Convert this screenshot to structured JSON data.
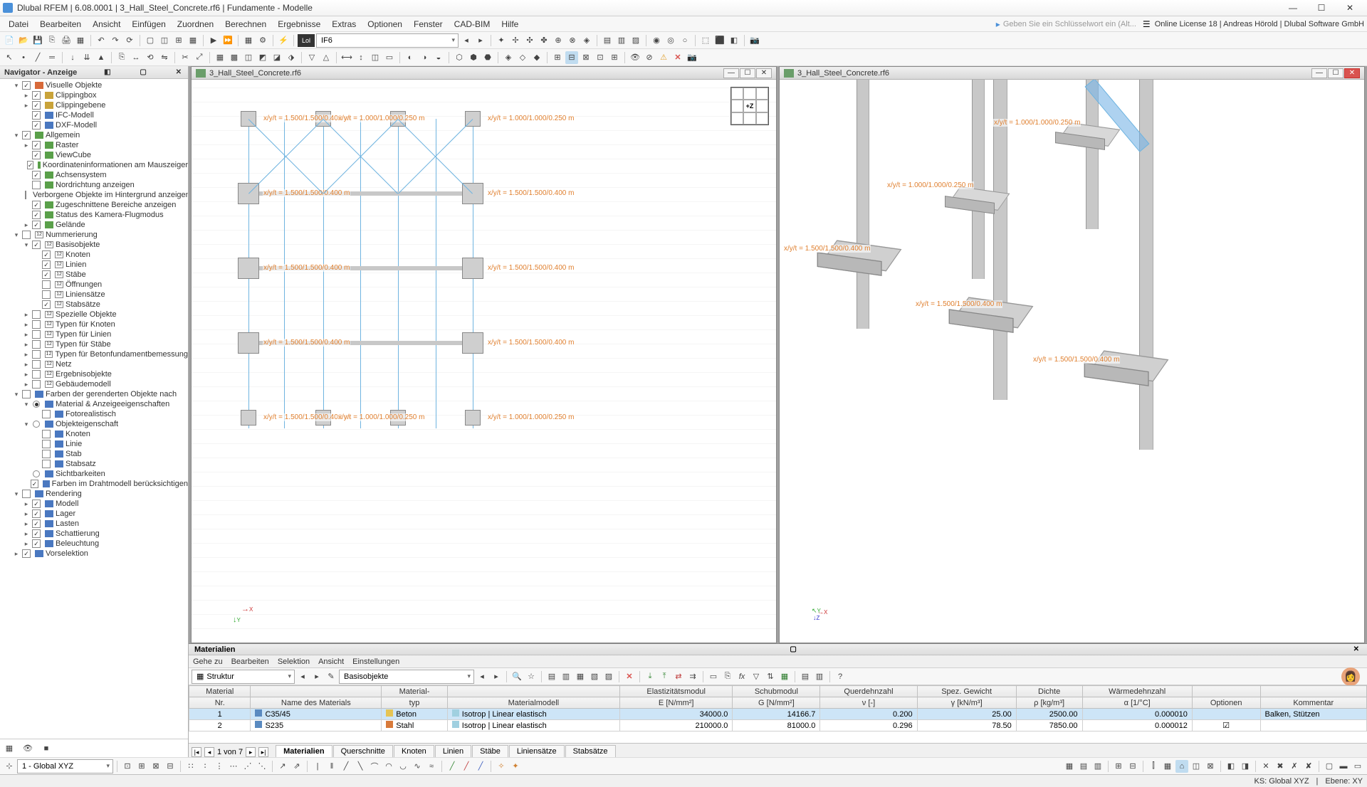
{
  "app": {
    "title": "Dlubal RFEM | 6.08.0001 | 3_Hall_Steel_Concrete.rf6 | Fundamente - Modelle",
    "search_placeholder": "Geben Sie ein Schlüsselwort ein (Alt...",
    "license": "Online License 18 | Andreas Hörold | Dlubal Software GmbH"
  },
  "menu": [
    "Datei",
    "Bearbeiten",
    "Ansicht",
    "Einfügen",
    "Zuordnen",
    "Berechnen",
    "Ergebnisse",
    "Extras",
    "Optionen",
    "Fenster",
    "CAD-BIM",
    "Hilfe"
  ],
  "toolbar2_combo": "IF6",
  "navigator": {
    "title": "Navigator - Anzeige",
    "items": [
      {
        "d": 1,
        "t": "exp",
        "chk": true,
        "ic": "col1",
        "label": "Visuelle Objekte"
      },
      {
        "d": 2,
        "t": "col",
        "chk": true,
        "ic": "col4",
        "label": "Clippingbox"
      },
      {
        "d": 2,
        "t": "col",
        "chk": true,
        "ic": "col4",
        "label": "Clippingebene"
      },
      {
        "d": 2,
        "t": "",
        "chk": true,
        "ic": "col3",
        "label": "IFC-Modell"
      },
      {
        "d": 2,
        "t": "",
        "chk": true,
        "ic": "col3",
        "label": "DXF-Modell"
      },
      {
        "d": 1,
        "t": "exp",
        "chk": true,
        "ic": "col2",
        "label": "Allgemein"
      },
      {
        "d": 2,
        "t": "col",
        "chk": true,
        "ic": "col2",
        "label": "Raster"
      },
      {
        "d": 2,
        "t": "",
        "chk": true,
        "ic": "col2",
        "label": "ViewCube"
      },
      {
        "d": 2,
        "t": "",
        "chk": true,
        "ic": "col2",
        "label": "Koordinateninformationen am Mauszeiger"
      },
      {
        "d": 2,
        "t": "",
        "chk": true,
        "ic": "col2",
        "label": "Achsensystem"
      },
      {
        "d": 2,
        "t": "",
        "chk": false,
        "ic": "col2",
        "label": "Nordrichtung anzeigen"
      },
      {
        "d": 2,
        "t": "",
        "chk": false,
        "ic": "col2",
        "label": "Verborgene Objekte im Hintergrund anzeigen"
      },
      {
        "d": 2,
        "t": "",
        "chk": true,
        "ic": "col2",
        "label": "Zugeschnittene Bereiche anzeigen"
      },
      {
        "d": 2,
        "t": "",
        "chk": true,
        "ic": "col2",
        "label": "Status des Kamera-Flugmodus"
      },
      {
        "d": 2,
        "t": "col",
        "chk": true,
        "ic": "col2",
        "label": "Gelände"
      },
      {
        "d": 1,
        "t": "exp",
        "chk": false,
        "ic": "num",
        "label": "Nummerierung"
      },
      {
        "d": 2,
        "t": "exp",
        "chk": true,
        "ic": "num",
        "label": "Basisobjekte"
      },
      {
        "d": 3,
        "t": "",
        "chk": true,
        "ic": "num",
        "label": "Knoten"
      },
      {
        "d": 3,
        "t": "",
        "chk": true,
        "ic": "num",
        "label": "Linien"
      },
      {
        "d": 3,
        "t": "",
        "chk": true,
        "ic": "num",
        "label": "Stäbe"
      },
      {
        "d": 3,
        "t": "",
        "chk": false,
        "ic": "num",
        "label": "Öffnungen"
      },
      {
        "d": 3,
        "t": "",
        "chk": false,
        "ic": "num",
        "label": "Liniensätze"
      },
      {
        "d": 3,
        "t": "",
        "chk": true,
        "ic": "num",
        "label": "Stabsätze"
      },
      {
        "d": 2,
        "t": "col",
        "chk": false,
        "ic": "num",
        "label": "Spezielle Objekte"
      },
      {
        "d": 2,
        "t": "col",
        "chk": false,
        "ic": "num",
        "label": "Typen für Knoten"
      },
      {
        "d": 2,
        "t": "col",
        "chk": false,
        "ic": "num",
        "label": "Typen für Linien"
      },
      {
        "d": 2,
        "t": "col",
        "chk": false,
        "ic": "num",
        "label": "Typen für Stäbe"
      },
      {
        "d": 2,
        "t": "col",
        "chk": false,
        "ic": "num",
        "label": "Typen für Betonfundamentbemessung"
      },
      {
        "d": 2,
        "t": "col",
        "chk": false,
        "ic": "num",
        "label": "Netz"
      },
      {
        "d": 2,
        "t": "col",
        "chk": false,
        "ic": "num",
        "label": "Ergebnisobjekte"
      },
      {
        "d": 2,
        "t": "col",
        "chk": false,
        "ic": "num",
        "label": "Gebäudemodell"
      },
      {
        "d": 1,
        "t": "exp",
        "chk": false,
        "ic": "col3",
        "label": "Farben der gerenderten Objekte nach"
      },
      {
        "d": 2,
        "t": "exp",
        "rad": true,
        "ic": "col3",
        "label": "Material & Anzeigeeigenschaften"
      },
      {
        "d": 3,
        "t": "",
        "chk": false,
        "ic": "col3",
        "label": "Fotorealistisch"
      },
      {
        "d": 2,
        "t": "exp",
        "rad": false,
        "ic": "col3",
        "label": "Objekteigenschaft"
      },
      {
        "d": 3,
        "t": "",
        "chk": false,
        "ic": "col3",
        "label": "Knoten"
      },
      {
        "d": 3,
        "t": "",
        "chk": false,
        "ic": "col3",
        "label": "Linie"
      },
      {
        "d": 3,
        "t": "",
        "chk": false,
        "ic": "col3",
        "label": "Stab"
      },
      {
        "d": 3,
        "t": "",
        "chk": false,
        "ic": "col3",
        "label": "Stabsatz"
      },
      {
        "d": 2,
        "t": "",
        "rad": false,
        "ic": "col3",
        "label": "Sichtbarkeiten"
      },
      {
        "d": 2,
        "t": "",
        "chk": true,
        "ic": "col3",
        "label": "Farben im Drahtmodell berücksichtigen"
      },
      {
        "d": 1,
        "t": "exp",
        "chk": false,
        "ic": "col3",
        "label": "Rendering"
      },
      {
        "d": 2,
        "t": "col",
        "chk": true,
        "ic": "col3",
        "label": "Modell"
      },
      {
        "d": 2,
        "t": "col",
        "chk": true,
        "ic": "col3",
        "label": "Lager"
      },
      {
        "d": 2,
        "t": "col",
        "chk": true,
        "ic": "col3",
        "label": "Lasten"
      },
      {
        "d": 2,
        "t": "col",
        "chk": true,
        "ic": "col3",
        "label": "Schattierung"
      },
      {
        "d": 2,
        "t": "col",
        "chk": true,
        "ic": "col3",
        "label": "Beleuchtung"
      },
      {
        "d": 1,
        "t": "col",
        "chk": true,
        "ic": "col3",
        "label": "Vorselektion"
      }
    ]
  },
  "view_name": "3_Hall_Steel_Concrete.rf6",
  "annotations": {
    "large": "x/y/t = 1.500/1.500/0.400 m",
    "small": "x/y/t = 1.000/1.000/0.250 m"
  },
  "cube_label": "+Z",
  "materials_panel": {
    "title": "Materialien",
    "menu": [
      "Gehe zu",
      "Bearbeiten",
      "Selektion",
      "Ansicht",
      "Einstellungen"
    ],
    "combo1": "Struktur",
    "combo2": "Basisobjekte",
    "cols": [
      {
        "h1": "Material",
        "h2": "Nr."
      },
      {
        "h1": "",
        "h2": "Name des Materials"
      },
      {
        "h1": "Material-",
        "h2": "typ"
      },
      {
        "h1": "",
        "h2": "Materialmodell"
      },
      {
        "h1": "Elastizitätsmodul",
        "h2": "E [N/mm²]"
      },
      {
        "h1": "Schubmodul",
        "h2": "G [N/mm²]"
      },
      {
        "h1": "Querdehnzahl",
        "h2": "ν [-]"
      },
      {
        "h1": "Spez. Gewicht",
        "h2": "γ [kN/m³]"
      },
      {
        "h1": "Dichte",
        "h2": "ρ [kg/m³]"
      },
      {
        "h1": "Wärmedehnzahl",
        "h2": "α [1/°C]"
      },
      {
        "h1": "",
        "h2": "Optionen"
      },
      {
        "h1": "",
        "h2": "Kommentar"
      }
    ],
    "rows": [
      {
        "nr": "1",
        "name": "C35/45",
        "swatch": "#e6c453",
        "typ": "Beton",
        "model": "Isotrop | Linear elastisch",
        "E": "34000.0",
        "G": "14166.7",
        "nu": "0.200",
        "gamma": "25.00",
        "rho": "2500.00",
        "alpha": "0.000010",
        "opt": "",
        "comment": "Balken, Stützen"
      },
      {
        "nr": "2",
        "name": "S235",
        "swatch": "#d87a3a",
        "typ": "Stahl",
        "model": "Isotrop | Linear elastisch",
        "E": "210000.0",
        "G": "81000.0",
        "nu": "0.296",
        "gamma": "78.50",
        "rho": "7850.00",
        "alpha": "0.000012",
        "opt": "☑",
        "comment": ""
      }
    ],
    "pager": "1 von 7",
    "tabs": [
      "Materialien",
      "Querschnitte",
      "Knoten",
      "Linien",
      "Stäbe",
      "Liniensätze",
      "Stabsätze"
    ]
  },
  "status": {
    "coord": "1 - Global XYZ",
    "ks": "KS: Global XYZ",
    "ebene": "Ebene: XY"
  }
}
